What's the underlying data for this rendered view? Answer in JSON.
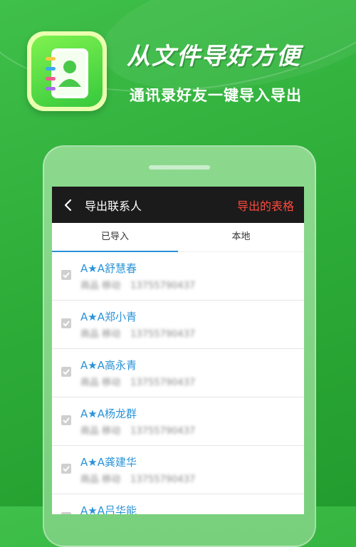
{
  "banner": {
    "title_main": "从文件导",
    "title_accent": "好方便",
    "subtitle": "通讯录好友一键导入导出"
  },
  "topbar": {
    "title": "导出联系人",
    "action": "导出的表格"
  },
  "tabs": [
    {
      "label": "已导入",
      "active": true
    },
    {
      "label": "本地",
      "active": false
    }
  ],
  "contacts": [
    {
      "name": "A★A舒慧春",
      "tag": "商品 移动",
      "phone": "13755790437",
      "checked": true
    },
    {
      "name": "A★A郑小青",
      "tag": "商品 移动",
      "phone": "13755790437",
      "checked": true
    },
    {
      "name": "A★A高永青",
      "tag": "商品 移动",
      "phone": "13755790437",
      "checked": true
    },
    {
      "name": "A★A杨龙群",
      "tag": "商品 移动",
      "phone": "13755790437",
      "checked": true
    },
    {
      "name": "A★A龚建华",
      "tag": "商品 移动",
      "phone": "13755790437",
      "checked": true
    },
    {
      "name": "A★A吕华能",
      "tag": "",
      "phone": "",
      "checked": true
    }
  ],
  "colors": {
    "background": "#2fae3a",
    "accent_yellow": "#f2ff3a",
    "export_red": "#ff4a3d",
    "contact_blue": "#2a93d8",
    "tab_underline": "#2a8fd6"
  },
  "icons": [
    "contacts-book-icon",
    "back-arrow-icon",
    "checkmark-icon"
  ]
}
